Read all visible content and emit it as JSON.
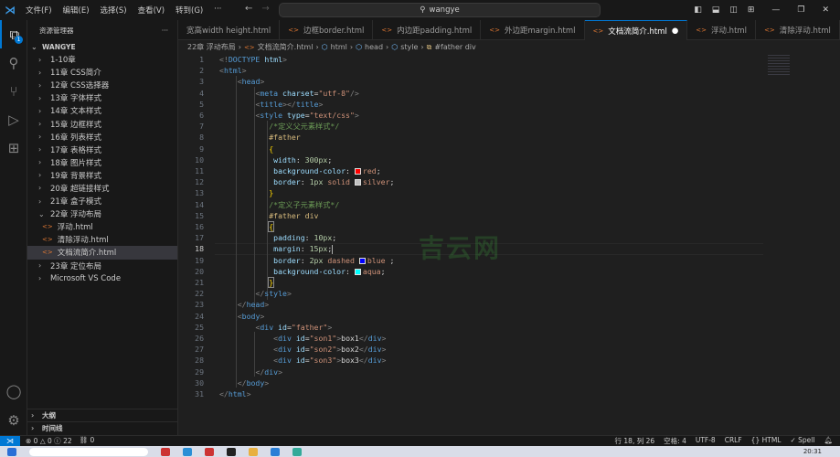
{
  "titlebar": {
    "menus": [
      "文件(F)",
      "编辑(E)",
      "选择(S)",
      "查看(V)",
      "转到(G)",
      "···"
    ],
    "search": "wangye"
  },
  "activity": {
    "explorer_badge": "1"
  },
  "sidebar": {
    "title": "资源管理器",
    "root": "WANGYE",
    "items": [
      {
        "label": "1-10章",
        "type": "folder",
        "open": false,
        "level": 1
      },
      {
        "label": "11章  CSS简介",
        "type": "folder",
        "open": false,
        "level": 1
      },
      {
        "label": "12章  CSS选择器",
        "type": "folder",
        "open": false,
        "level": 1
      },
      {
        "label": "13章  字体样式",
        "type": "folder",
        "open": false,
        "level": 1
      },
      {
        "label": "14章  文本样式",
        "type": "folder",
        "open": false,
        "level": 1
      },
      {
        "label": "15章  边框样式",
        "type": "folder",
        "open": false,
        "level": 1
      },
      {
        "label": "16章  列表样式",
        "type": "folder",
        "open": false,
        "level": 1
      },
      {
        "label": "17章  表格样式",
        "type": "folder",
        "open": false,
        "level": 1
      },
      {
        "label": "18章  图片样式",
        "type": "folder",
        "open": false,
        "level": 1
      },
      {
        "label": "19章  背景样式",
        "type": "folder",
        "open": false,
        "level": 1
      },
      {
        "label": "20章  超链接样式",
        "type": "folder",
        "open": false,
        "level": 1
      },
      {
        "label": "21章  盒子模式",
        "type": "folder",
        "open": false,
        "level": 1
      },
      {
        "label": "22章  浮动布局",
        "type": "folder",
        "open": true,
        "level": 1
      },
      {
        "label": "浮动.html",
        "type": "file",
        "level": 2
      },
      {
        "label": "清除浮动.html",
        "type": "file",
        "level": 2
      },
      {
        "label": "文档流简介.html",
        "type": "file",
        "level": 2,
        "selected": true
      },
      {
        "label": "23章  定位布局",
        "type": "folder",
        "open": false,
        "level": 1
      },
      {
        "label": "Microsoft VS Code",
        "type": "folder",
        "open": false,
        "level": 1
      }
    ],
    "outline": "大纲",
    "timeline": "时间线"
  },
  "tabs": [
    {
      "label": "宽高width height.html",
      "icon": false
    },
    {
      "label": "边框border.html",
      "icon": true
    },
    {
      "label": "内边距padding.html",
      "icon": true
    },
    {
      "label": "外边距margin.html",
      "icon": true
    },
    {
      "label": "文档流简介.html",
      "icon": true,
      "active": true,
      "dirty": true
    },
    {
      "label": "浮动.html",
      "icon": true
    },
    {
      "label": "清除浮动.html",
      "icon": true
    }
  ],
  "breadcrumb": [
    "22章  浮动布局",
    "文档流简介.html",
    "html",
    "head",
    "style",
    "#father div"
  ],
  "editor": {
    "current_line": 18,
    "lines": [
      [
        [
          "t-p",
          "<!"
        ],
        [
          "t-tag",
          "DOCTYPE"
        ],
        [
          "t-txt",
          " "
        ],
        [
          "t-attr",
          "html"
        ],
        [
          "t-p",
          ">"
        ]
      ],
      [
        [
          "t-p",
          "<"
        ],
        [
          "t-tag",
          "html"
        ],
        [
          "t-p",
          ">"
        ]
      ],
      [
        [
          "t-txt",
          "    "
        ],
        [
          "t-p",
          "<"
        ],
        [
          "t-tag",
          "head"
        ],
        [
          "t-p",
          ">"
        ]
      ],
      [
        [
          "t-txt",
          "        "
        ],
        [
          "t-p",
          "<"
        ],
        [
          "t-tag",
          "meta"
        ],
        [
          "t-txt",
          " "
        ],
        [
          "t-attr",
          "charset"
        ],
        [
          "t-txt",
          "="
        ],
        [
          "t-str",
          "\"utf-8\""
        ],
        [
          "t-p",
          "/>"
        ]
      ],
      [
        [
          "t-txt",
          "        "
        ],
        [
          "t-p",
          "<"
        ],
        [
          "t-tag",
          "title"
        ],
        [
          "t-p",
          "></"
        ],
        [
          "t-tag",
          "title"
        ],
        [
          "t-p",
          ">"
        ]
      ],
      [
        [
          "t-txt",
          "        "
        ],
        [
          "t-p",
          "<"
        ],
        [
          "t-tag",
          "style"
        ],
        [
          "t-txt",
          " "
        ],
        [
          "t-attr",
          "type"
        ],
        [
          "t-txt",
          "="
        ],
        [
          "t-str",
          "\"text/css\""
        ],
        [
          "t-p",
          ">"
        ]
      ],
      [
        [
          "t-txt",
          "           "
        ],
        [
          "t-com",
          "/*定义父元素样式*/"
        ]
      ],
      [
        [
          "t-txt",
          "           "
        ],
        [
          "t-sel",
          "#father"
        ]
      ],
      [
        [
          "t-txt",
          "           "
        ],
        [
          "t-br",
          "{"
        ]
      ],
      [
        [
          "t-txt",
          "            "
        ],
        [
          "t-prop",
          "width"
        ],
        [
          "t-txt",
          ": "
        ],
        [
          "t-num",
          "300px"
        ],
        [
          "t-txt",
          ";"
        ]
      ],
      [
        [
          "t-txt",
          "            "
        ],
        [
          "t-prop",
          "background-color"
        ],
        [
          "t-txt",
          ": "
        ],
        [
          "sw",
          "#ff0000"
        ],
        [
          "t-val",
          "red"
        ],
        [
          "t-txt",
          ";"
        ]
      ],
      [
        [
          "t-txt",
          "            "
        ],
        [
          "t-prop",
          "border"
        ],
        [
          "t-txt",
          ": "
        ],
        [
          "t-num",
          "1px"
        ],
        [
          "t-txt",
          " "
        ],
        [
          "t-val",
          "solid"
        ],
        [
          "t-txt",
          " "
        ],
        [
          "sw",
          "#c0c0c0"
        ],
        [
          "t-val",
          "silver"
        ],
        [
          "t-txt",
          ";"
        ]
      ],
      [
        [
          "t-txt",
          "           "
        ],
        [
          "t-br",
          "}"
        ]
      ],
      [
        [
          "t-txt",
          "           "
        ],
        [
          "t-com",
          "/*定义子元素样式*/"
        ]
      ],
      [
        [
          "t-txt",
          "           "
        ],
        [
          "t-sel",
          "#father div"
        ]
      ],
      [
        [
          "t-txt",
          "           "
        ],
        [
          "t-brm",
          "{"
        ]
      ],
      [
        [
          "t-txt",
          "            "
        ],
        [
          "t-prop",
          "padding"
        ],
        [
          "t-txt",
          ": "
        ],
        [
          "t-num",
          "10px"
        ],
        [
          "t-txt",
          ";"
        ]
      ],
      [
        [
          "t-txt",
          "            "
        ],
        [
          "t-prop",
          "margin"
        ],
        [
          "t-txt",
          ": "
        ],
        [
          "t-num",
          "15px"
        ],
        [
          "t-txt",
          ";"
        ],
        [
          "caret",
          ""
        ]
      ],
      [
        [
          "t-txt",
          "            "
        ],
        [
          "t-prop",
          "border"
        ],
        [
          "t-txt",
          ": "
        ],
        [
          "t-num",
          "2px"
        ],
        [
          "t-txt",
          " "
        ],
        [
          "t-val",
          "dashed"
        ],
        [
          "t-txt",
          " "
        ],
        [
          "sw",
          "#0000ff"
        ],
        [
          "t-val",
          "blue"
        ],
        [
          "t-txt",
          " ;"
        ]
      ],
      [
        [
          "t-txt",
          "            "
        ],
        [
          "t-prop",
          "background-color"
        ],
        [
          "t-txt",
          ": "
        ],
        [
          "sw",
          "#00ffff"
        ],
        [
          "t-val",
          "aqua"
        ],
        [
          "t-txt",
          ";"
        ]
      ],
      [
        [
          "t-txt",
          "           "
        ],
        [
          "t-brm",
          "}"
        ]
      ],
      [
        [
          "t-txt",
          "        "
        ],
        [
          "t-p",
          "</"
        ],
        [
          "t-tag",
          "style"
        ],
        [
          "t-p",
          ">"
        ]
      ],
      [
        [
          "t-txt",
          "    "
        ],
        [
          "t-p",
          "</"
        ],
        [
          "t-tag",
          "head"
        ],
        [
          "t-p",
          ">"
        ]
      ],
      [
        [
          "t-txt",
          "    "
        ],
        [
          "t-p",
          "<"
        ],
        [
          "t-tag",
          "body"
        ],
        [
          "t-p",
          ">"
        ]
      ],
      [
        [
          "t-txt",
          "        "
        ],
        [
          "t-p",
          "<"
        ],
        [
          "t-tag",
          "div"
        ],
        [
          "t-txt",
          " "
        ],
        [
          "t-attr",
          "id"
        ],
        [
          "t-txt",
          "="
        ],
        [
          "t-str",
          "\"father\""
        ],
        [
          "t-p",
          ">"
        ]
      ],
      [
        [
          "t-txt",
          "            "
        ],
        [
          "t-p",
          "<"
        ],
        [
          "t-tag",
          "div"
        ],
        [
          "t-txt",
          " "
        ],
        [
          "t-attr",
          "id"
        ],
        [
          "t-txt",
          "="
        ],
        [
          "t-str",
          "\"son1\""
        ],
        [
          "t-p",
          ">"
        ],
        [
          "t-txt",
          "box1"
        ],
        [
          "t-p",
          "</"
        ],
        [
          "t-tag",
          "div"
        ],
        [
          "t-p",
          ">"
        ]
      ],
      [
        [
          "t-txt",
          "            "
        ],
        [
          "t-p",
          "<"
        ],
        [
          "t-tag",
          "div"
        ],
        [
          "t-txt",
          " "
        ],
        [
          "t-attr",
          "id"
        ],
        [
          "t-txt",
          "="
        ],
        [
          "t-str",
          "\"son2\""
        ],
        [
          "t-p",
          ">"
        ],
        [
          "t-txt",
          "box2"
        ],
        [
          "t-p",
          "</"
        ],
        [
          "t-tag",
          "div"
        ],
        [
          "t-p",
          ">"
        ]
      ],
      [
        [
          "t-txt",
          "            "
        ],
        [
          "t-p",
          "<"
        ],
        [
          "t-tag",
          "div"
        ],
        [
          "t-txt",
          " "
        ],
        [
          "t-attr",
          "id"
        ],
        [
          "t-txt",
          "="
        ],
        [
          "t-str",
          "\"son3\""
        ],
        [
          "t-p",
          ">"
        ],
        [
          "t-txt",
          "box3"
        ],
        [
          "t-p",
          "</"
        ],
        [
          "t-tag",
          "div"
        ],
        [
          "t-p",
          ">"
        ]
      ],
      [
        [
          "t-txt",
          "        "
        ],
        [
          "t-p",
          "</"
        ],
        [
          "t-tag",
          "div"
        ],
        [
          "t-p",
          ">"
        ]
      ],
      [
        [
          "t-txt",
          "    "
        ],
        [
          "t-p",
          "</"
        ],
        [
          "t-tag",
          "body"
        ],
        [
          "t-p",
          ">"
        ]
      ],
      [
        [
          "t-p",
          "</"
        ],
        [
          "t-tag",
          "html"
        ],
        [
          "t-p",
          ">"
        ]
      ]
    ]
  },
  "watermark": "吉云网",
  "status": {
    "errors": "0",
    "warnings": "0",
    "info": "22",
    "ports": "0",
    "position": "行 18, 列 26",
    "spaces": "空格: 4",
    "encoding": "UTF-8",
    "eol": "CRLF",
    "language": "HTML",
    "spell": "Spell"
  },
  "taskbar": {
    "time": "20:31"
  }
}
